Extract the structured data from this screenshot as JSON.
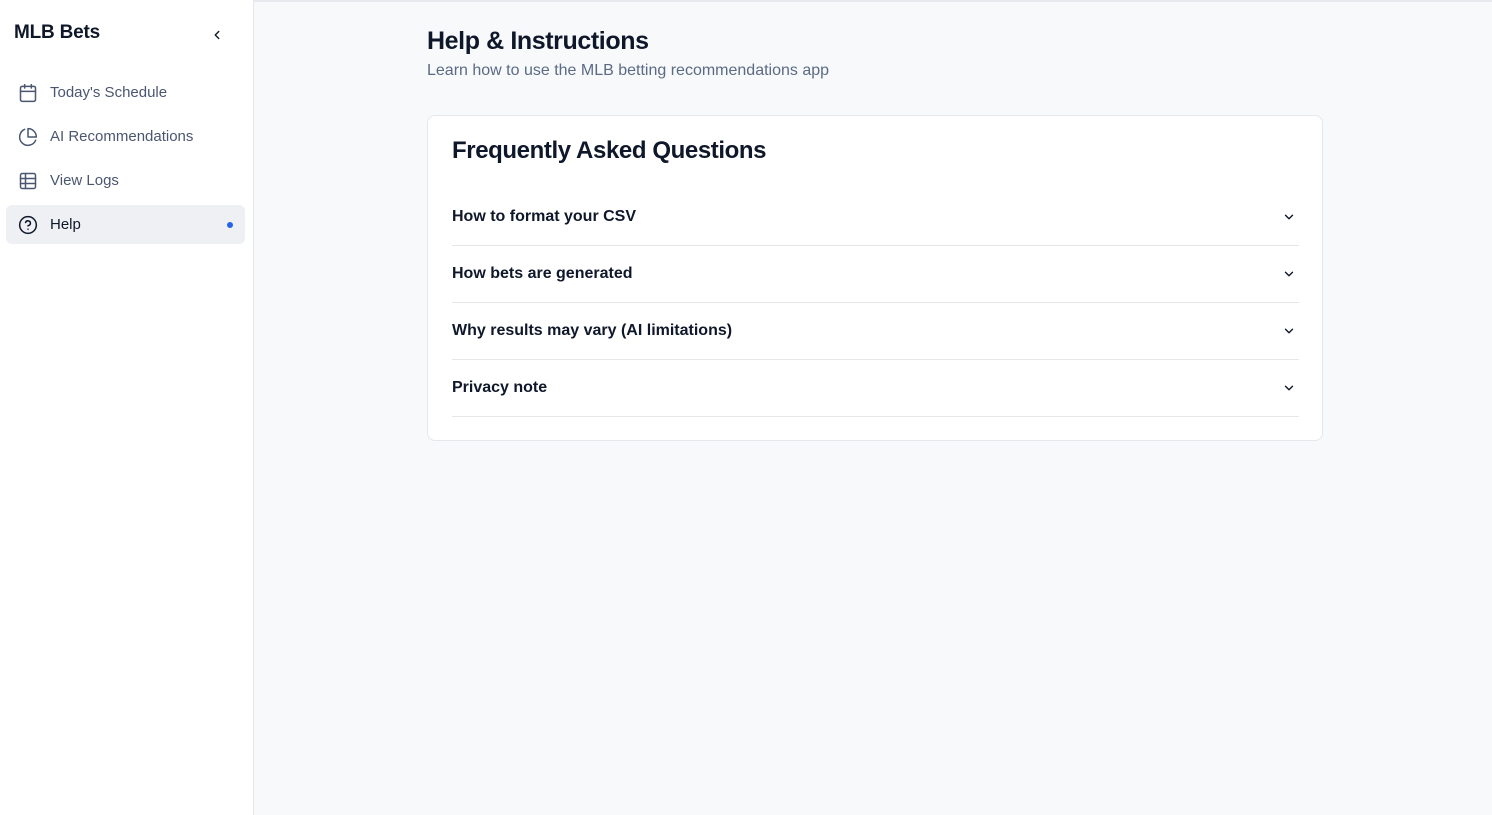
{
  "sidebar": {
    "brand": "MLB Bets",
    "collapse_icon": "chevron-left-icon",
    "items": [
      {
        "label": "Today's Schedule",
        "icon": "calendar-icon",
        "active": false
      },
      {
        "label": "AI Recommendations",
        "icon": "pie-chart-icon",
        "active": false
      },
      {
        "label": "View Logs",
        "icon": "table-icon",
        "active": false
      },
      {
        "label": "Help",
        "icon": "help-circle-icon",
        "active": true
      }
    ]
  },
  "main": {
    "title": "Help & Instructions",
    "subtitle": "Learn how to use the MLB betting recommendations app"
  },
  "faq": {
    "title": "Frequently Asked Questions",
    "items": [
      {
        "question": "How to format your CSV"
      },
      {
        "question": "How bets are generated"
      },
      {
        "question": "Why results may vary (AI limitations)"
      },
      {
        "question": "Privacy note"
      }
    ]
  },
  "colors": {
    "accent": "#2563eb",
    "active_bg": "#eef0f4",
    "page_bg": "#f8f9fb"
  }
}
